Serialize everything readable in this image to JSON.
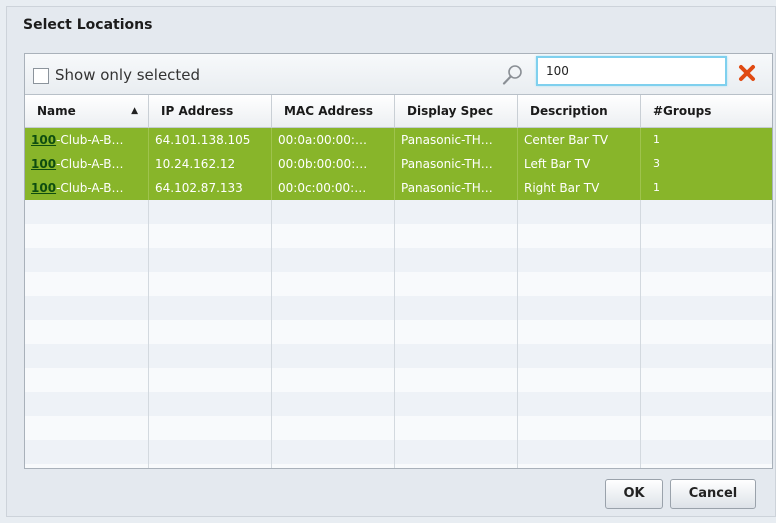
{
  "dialog": {
    "title": "Select Locations",
    "show_only_selected_label": "Show only selected",
    "show_only_selected_checked": false,
    "search": {
      "value": "100",
      "placeholder": ""
    },
    "ok_label": "OK",
    "cancel_label": "Cancel"
  },
  "table": {
    "columns": [
      {
        "label": "Name",
        "sorted": "ascending",
        "sort_indicator": "▲"
      },
      {
        "label": "IP Address"
      },
      {
        "label": "MAC Address"
      },
      {
        "label": "Display Spec"
      },
      {
        "label": "Description"
      },
      {
        "label": "#Groups"
      }
    ],
    "rows": [
      {
        "name_match": "100",
        "name_rest": "-Club-A-B…",
        "ip": "64.101.138.105",
        "mac": "00:0a:00:00:…",
        "display_spec": "Panasonic-TH…",
        "description": "Center Bar TV",
        "groups": "1"
      },
      {
        "name_match": "100",
        "name_rest": "-Club-A-B…",
        "ip": "10.24.162.12",
        "mac": "00:0b:00:00:…",
        "display_spec": "Panasonic-TH…",
        "description": "Left Bar TV",
        "groups": "3"
      },
      {
        "name_match": "100",
        "name_rest": "-Club-A-B…",
        "ip": "64.102.87.133",
        "mac": "00:0c:00:00:…",
        "display_spec": "Panasonic-TH…",
        "description": "Right Bar TV",
        "groups": "1"
      }
    ]
  },
  "colors": {
    "selected_row": "#88b52a",
    "search_match_highlight": "#0e4d10",
    "clear_icon": "#e04a12",
    "search_focus_border": "#7fd0ee"
  },
  "icons": {
    "search": "search-icon",
    "clear": "close-icon",
    "sort": "sort-ascending-icon"
  }
}
